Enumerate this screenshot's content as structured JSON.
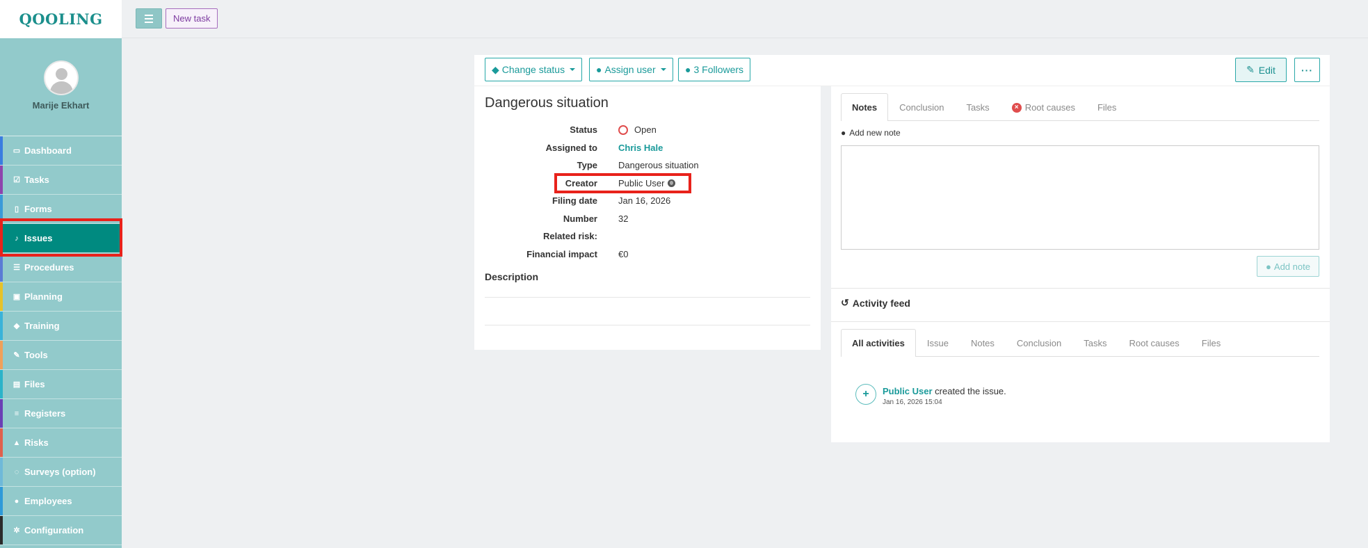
{
  "app": {
    "logo_text": "QOOLING"
  },
  "topbar": {
    "new_task_label": "New task"
  },
  "user": {
    "name": "Marije Ekhart"
  },
  "sidebar": {
    "items": [
      {
        "label": "Dashboard",
        "icon": "monitor-icon",
        "stripe": "#3a7de0"
      },
      {
        "label": "Tasks",
        "icon": "check-square-icon",
        "stripe": "#8e44ad"
      },
      {
        "label": "Forms",
        "icon": "file-icon",
        "stripe": "#3a9ad9"
      },
      {
        "label": "Issues",
        "icon": "bell-icon",
        "stripe": "#008a80"
      },
      {
        "label": "Procedures",
        "icon": "list-alt-icon",
        "stripe": "#5b7bd5"
      },
      {
        "label": "Planning",
        "icon": "calendar-icon",
        "stripe": "#e6c229"
      },
      {
        "label": "Training",
        "icon": "graduation-cap-icon",
        "stripe": "#3ab3d9"
      },
      {
        "label": "Tools",
        "icon": "wrench-icon",
        "stripe": "#f0a05a"
      },
      {
        "label": "Files",
        "icon": "file-text-icon",
        "stripe": "#2bb3c9"
      },
      {
        "label": "Registers",
        "icon": "list-icon",
        "stripe": "#6a3fb5"
      },
      {
        "label": "Risks",
        "icon": "warning-icon",
        "stripe": "#e0604d"
      },
      {
        "label": "Surveys (option)",
        "icon": "comment-icon",
        "stripe": "#6fb9d9"
      },
      {
        "label": "Employees",
        "icon": "users-icon",
        "stripe": "#2e9ad9"
      },
      {
        "label": "Configuration",
        "icon": "gear-icon",
        "stripe": "#2b2b2b"
      }
    ],
    "active": "Issues"
  },
  "actions": {
    "change_status": "Change status",
    "assign_user": "Assign user",
    "followers": "3 Followers",
    "edit": "Edit"
  },
  "issue": {
    "title": "Dangerous situation",
    "fields": {
      "status": {
        "label": "Status",
        "value": "Open"
      },
      "assigned_to": {
        "label": "Assigned to",
        "value": "Chris Hale"
      },
      "type": {
        "label": "Type",
        "value": "Dangerous situation"
      },
      "creator": {
        "label": "Creator",
        "value": "Public User"
      },
      "filing_date": {
        "label": "Filing date",
        "value": "Jan 16, 2026"
      },
      "number": {
        "label": "Number",
        "value": "32"
      },
      "related_risk": {
        "label": "Related risk:",
        "value": ""
      },
      "financial_impact": {
        "label": "Financial impact",
        "value": "€0"
      }
    },
    "description_title": "Description"
  },
  "detail_tabs": [
    "Notes",
    "Conclusion",
    "Tasks",
    "Root causes",
    "Files"
  ],
  "notes": {
    "add_new_note": "Add new note",
    "add_note_button": "Add note"
  },
  "activity": {
    "title": "Activity feed",
    "tabs": [
      "All activities",
      "Issue",
      "Notes",
      "Conclusion",
      "Tasks",
      "Root causes",
      "Files"
    ],
    "items": [
      {
        "user": "Public User",
        "action": "created the issue.",
        "time": "Jan 16, 2026 15:04"
      }
    ]
  },
  "colors": {
    "brand": "#1b8f8c",
    "sidebar_bg": "#92cacb",
    "active_nav": "#008a80",
    "highlight_outline": "#e8221b"
  }
}
